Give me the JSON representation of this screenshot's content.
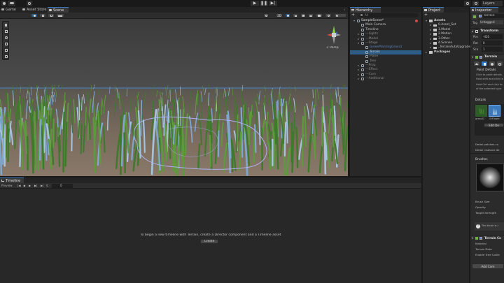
{
  "toolbar": {
    "play": "▶",
    "pause": "❚❚",
    "step": "▶|",
    "layers_label": "Layers"
  },
  "scene_tabs": [
    {
      "label": "Game"
    },
    {
      "label": "Asset Store"
    },
    {
      "label": "Scene"
    }
  ],
  "scene": {
    "persp_label": "< Persp",
    "mode_2d": "2D"
  },
  "hierarchy": {
    "tab": "Hierarchy",
    "search_placeholder": "All",
    "items": [
      {
        "label": "SampleScene*",
        "indent": 0
      },
      {
        "label": "Main Camera",
        "indent": 1
      },
      {
        "label": "Timeline",
        "indent": 1
      },
      {
        "label": "---Lights",
        "indent": 1
      },
      {
        "label": "---Model",
        "indent": 1
      },
      {
        "label": "---Stage",
        "indent": 1
      },
      {
        "label": "GreenPlantingGrass1",
        "indent": 2
      },
      {
        "label": "Terrain",
        "indent": 2
      },
      {
        "label": "Plane",
        "indent": 2
      },
      {
        "label": "Tree",
        "indent": 2
      },
      {
        "label": "---Prop",
        "indent": 1
      },
      {
        "label": "---Effect",
        "indent": 1
      },
      {
        "label": "---Cam",
        "indent": 1
      },
      {
        "label": "---Additional",
        "indent": 1
      }
    ]
  },
  "project": {
    "tab": "Project",
    "items": [
      {
        "label": "Assets",
        "indent": 0
      },
      {
        "label": "0.Asset_Set",
        "indent": 1
      },
      {
        "label": "1.Model",
        "indent": 1
      },
      {
        "label": "2.Motion",
        "indent": 1
      },
      {
        "label": "3.Other",
        "indent": 1
      },
      {
        "label": "4.Scenes",
        "indent": 1
      },
      {
        "label": "_TerrainAutoUpgrade",
        "indent": 1
      },
      {
        "label": "Packages",
        "indent": 0
      }
    ]
  },
  "inspector": {
    "tab": "Inspector",
    "object_name": "Terrain",
    "tag_label": "Tag",
    "tag_value": "Untagged",
    "transform_title": "Transform",
    "transform_rows": [
      {
        "axis": "Pos",
        "value": "-420"
      },
      {
        "axis": "Rot",
        "value": "0"
      },
      {
        "axis": "Sca",
        "value": "1"
      }
    ],
    "terrain_title": "Terrain",
    "paint_details_title": "Paint Details",
    "paint_details_desc": [
      "Click to paint details.",
      "Hold shift and click to",
      "Hold Ctrl and click to",
      "of the selected type."
    ],
    "details_title": "Details",
    "detail_items": [
      {
        "label": "grass02"
      },
      {
        "label": "GrFlower"
      }
    ],
    "edit_details_button": "Edit De",
    "detail_patches": "Detail patches cu",
    "detail_instance": "Detail instance de",
    "brushes_title": "Brushes",
    "brush_size_label": "Brush Size",
    "opacity_label": "Opacity",
    "target_strength_label": "Target Strength",
    "brush_info": "The brush is r",
    "terrain_collider_title": "Terrain Co",
    "collider_rows": [
      "Material",
      "Terrain Data",
      "Enable Tree Collid"
    ],
    "add_component_button": "Add Com"
  },
  "timeline": {
    "tab": "Timeline",
    "preview_label": "Preview",
    "frame_value": "0",
    "message": "To begin a new timeline with Terrain, create a Director component and a Timeline asset",
    "create_button": "Create"
  },
  "colors": {
    "accent": "#3a79bb",
    "selection": "#2c5d87",
    "sky": "#4a4a4a",
    "ground": "#7a6a5e",
    "grass": "#3f7a2c",
    "flower": "#a6c3de",
    "brush_outline": "#b0b8ff"
  }
}
